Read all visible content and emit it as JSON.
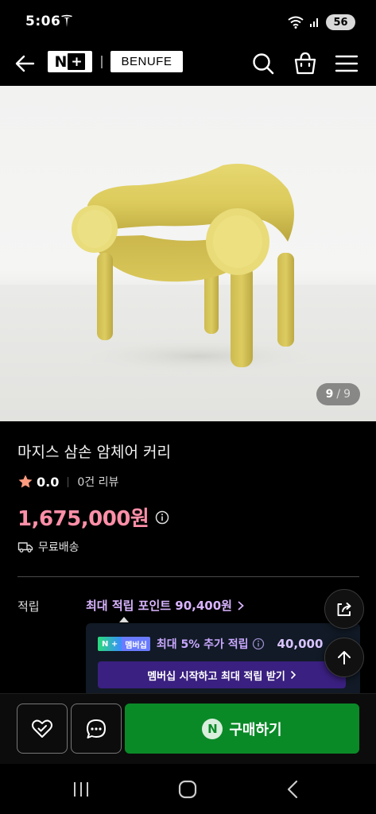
{
  "status": {
    "time": "5:06",
    "battery": "56"
  },
  "header": {
    "logo_n": "N",
    "logo_plus": "+",
    "brand": "BENUFE",
    "icons": [
      "back-arrow-icon",
      "search-icon",
      "shopping-bag-icon",
      "menu-icon"
    ]
  },
  "gallery": {
    "current": "9",
    "separator": "/",
    "total": "9"
  },
  "product": {
    "title": "마지스 삼손 암체어 커리",
    "rating": "0.0",
    "reviews": "0건 리뷰",
    "price": "1,675,000원",
    "shipping": "무료배송"
  },
  "points": {
    "label": "적립",
    "max_points": "최대 적립 포인트 90,400원",
    "membership_badge_np": "N +",
    "membership_badge_label": "멤버십",
    "membership_text": "최대 5% 추가 적립",
    "membership_amount": "40,000",
    "membership_button": "멤버십 시작하고 최대 적립 받기"
  },
  "bottom": {
    "buy_icon": "N",
    "buy_label": "구매하기"
  },
  "colors": {
    "price": "#ff8fa8",
    "points": "#d8b4ff",
    "buy_button": "#0a8a27",
    "chair": "#d9c75a"
  }
}
